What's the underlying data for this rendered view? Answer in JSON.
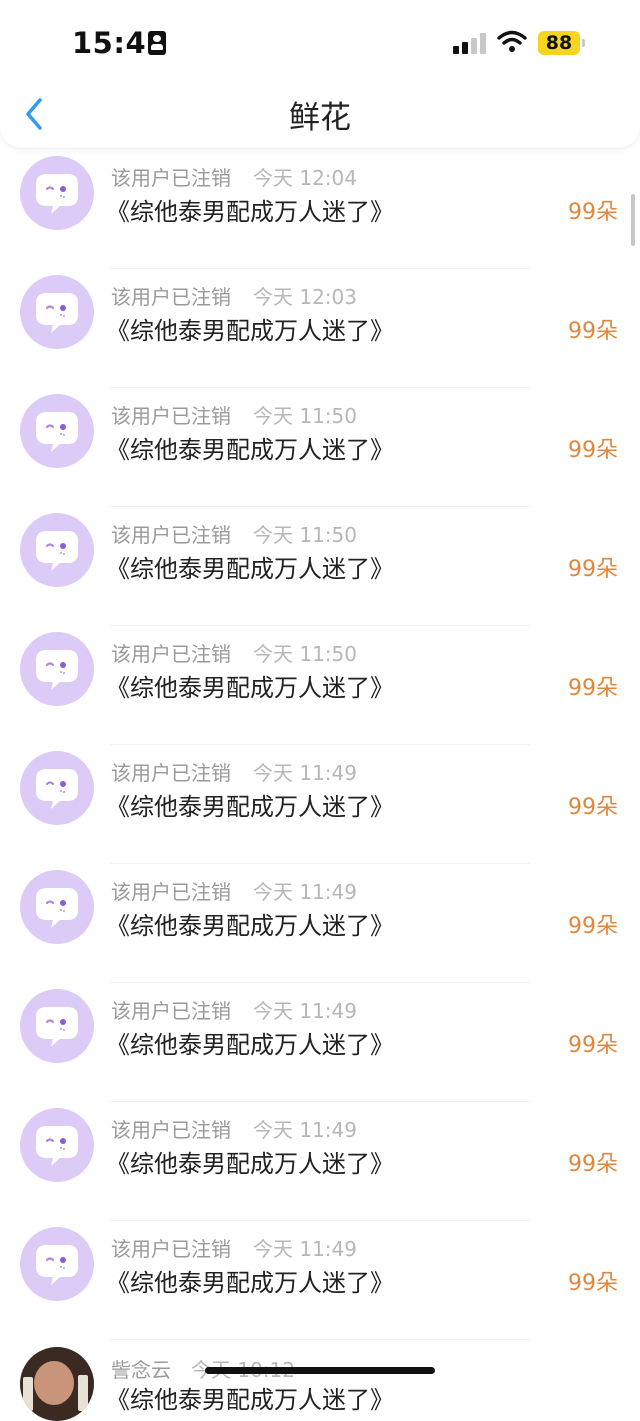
{
  "status_bar": {
    "time": "15:45",
    "battery": "88"
  },
  "nav": {
    "title": "鲜花"
  },
  "gifts": [
    {
      "user": "该用户已注销",
      "time": "今天 12:04",
      "book": "《综他泰男配成万人迷了》",
      "count": "99朵"
    },
    {
      "user": "该用户已注销",
      "time": "今天 12:03",
      "book": "《综他泰男配成万人迷了》",
      "count": "99朵"
    },
    {
      "user": "该用户已注销",
      "time": "今天 11:50",
      "book": "《综他泰男配成万人迷了》",
      "count": "99朵"
    },
    {
      "user": "该用户已注销",
      "time": "今天 11:50",
      "book": "《综他泰男配成万人迷了》",
      "count": "99朵"
    },
    {
      "user": "该用户已注销",
      "time": "今天 11:50",
      "book": "《综他泰男配成万人迷了》",
      "count": "99朵"
    },
    {
      "user": "该用户已注销",
      "time": "今天 11:49",
      "book": "《综他泰男配成万人迷了》",
      "count": "99朵"
    },
    {
      "user": "该用户已注销",
      "time": "今天 11:49",
      "book": "《综他泰男配成万人迷了》",
      "count": "99朵"
    },
    {
      "user": "该用户已注销",
      "time": "今天 11:49",
      "book": "《综他泰男配成万人迷了》",
      "count": "99朵"
    },
    {
      "user": "该用户已注销",
      "time": "今天 11:49",
      "book": "《综他泰男配成万人迷了》",
      "count": "99朵"
    },
    {
      "user": "该用户已注销",
      "time": "今天 11:49",
      "book": "《综他泰男配成万人迷了》",
      "count": "99朵"
    }
  ],
  "partial_row": {
    "user": "訾念云",
    "time": "今天 10:12",
    "book": "《综他泰男配成万人迷了》"
  },
  "icons": {
    "avatar": "default-chat-bubble-avatar",
    "back": "chevron-left-icon",
    "signal": "cellular-signal-icon",
    "wifi": "wifi-icon"
  },
  "colors": {
    "accent": "#2e9bf0",
    "count": "#e0873e",
    "avatar_bg": "#dccbf6",
    "battery": "#f7d51e"
  }
}
